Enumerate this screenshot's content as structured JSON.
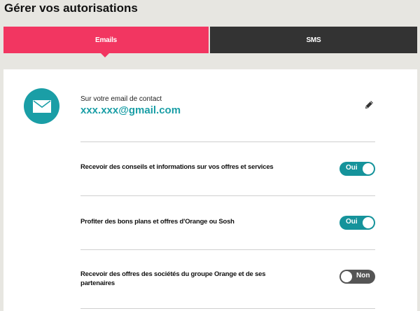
{
  "page": {
    "title": "Gérer vos autorisations"
  },
  "tabs": [
    {
      "label": "Emails",
      "active": true
    },
    {
      "label": "SMS",
      "active": false
    }
  ],
  "contact": {
    "label": "Sur votre email de contact",
    "email": "xxx.xxx@gmail.com",
    "icon": "mail-icon",
    "edit_icon": "pencil-icon"
  },
  "preferences": [
    {
      "label": "Recevoir des conseils et informations sur vos offres et services",
      "state": "Oui",
      "on": true
    },
    {
      "label": "Profiter des bons plans et offres d'Orange ou Sosh",
      "state": "Oui",
      "on": true
    },
    {
      "label": "Recevoir des offres des sociétés du groupe Orange et de ses partenaires",
      "state": "Non",
      "on": false
    }
  ],
  "colors": {
    "accent": "#f23661",
    "teal": "#1a9ea6",
    "dark": "#333333",
    "background": "#e7e6e1"
  }
}
